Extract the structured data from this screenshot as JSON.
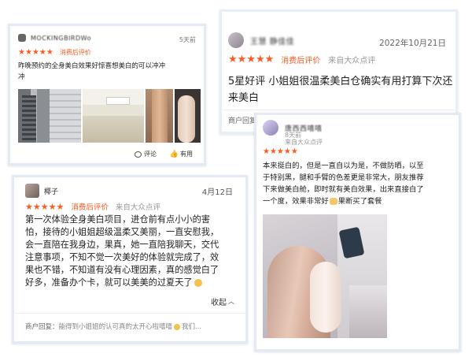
{
  "colors": {
    "accent": "#ff5a1f",
    "muted": "#999999",
    "text": "#222222",
    "card_border": "#e3eaf5"
  },
  "card1": {
    "username": "MOCKINGBIRDWo",
    "stars": "★★★★★",
    "tag": "消费后评价",
    "time": "5天前",
    "text_line1": "昨晚预约的全身美白效果好惊喜想美白的可以冲冲",
    "text_line2": "冲",
    "comment_icon": "comment-icon",
    "comment_label": "评论",
    "like_icon": "thumbs-up-icon",
    "like_label": "有用"
  },
  "card2": {
    "username": "王慧 静佳佳",
    "date": "2022年10月21日",
    "stars": "★★★★★",
    "tag": "消费后评价",
    "source": "来自大众点评",
    "text_line1": "5星好评 小姐姐很温柔美白仓确实有用打算下次还",
    "text_line2": "来美白",
    "merchant_label": "商户回复"
  },
  "card3": {
    "username": "椰子",
    "date": "4月12日",
    "stars": "★★★★★",
    "tag": "消费后评价",
    "source": "来自大众点评",
    "lines": [
      "第一次体验全身美白项目，进仓前有点小小的害",
      "怕，接待的小姐姐超级温柔又美丽，一直安慰我，",
      "会一直陪在我身边，果真，她一直陪我聊天，交代",
      "注意事项，不知不觉一次美好的体验就完成了，效",
      "果也不错，不知道有没有心理因素，真的感觉白了",
      "好多，准备办个卡，就可以美美的过夏天了"
    ],
    "collapse_label": "收起",
    "reply_label": "商户回复：",
    "reply_text": "能得到小姐姐的认可真的太开心啦嘻嘻",
    "reply_more": "我们..."
  },
  "card4": {
    "username": "唐西西嘻嘻",
    "time": "8天前",
    "source": "来自大众点评",
    "stars": "★★★★★",
    "lines": [
      "本来挺白的，但是一直自以为是，不做防晒，以至",
      "于特别黑，腿和手臂的色差更是非常大，朋友推荐",
      "下来做美白舱，即时就有美白效果，出来直接白了",
      "一个度，效果非常好",
      "果断买了套餐"
    ]
  }
}
